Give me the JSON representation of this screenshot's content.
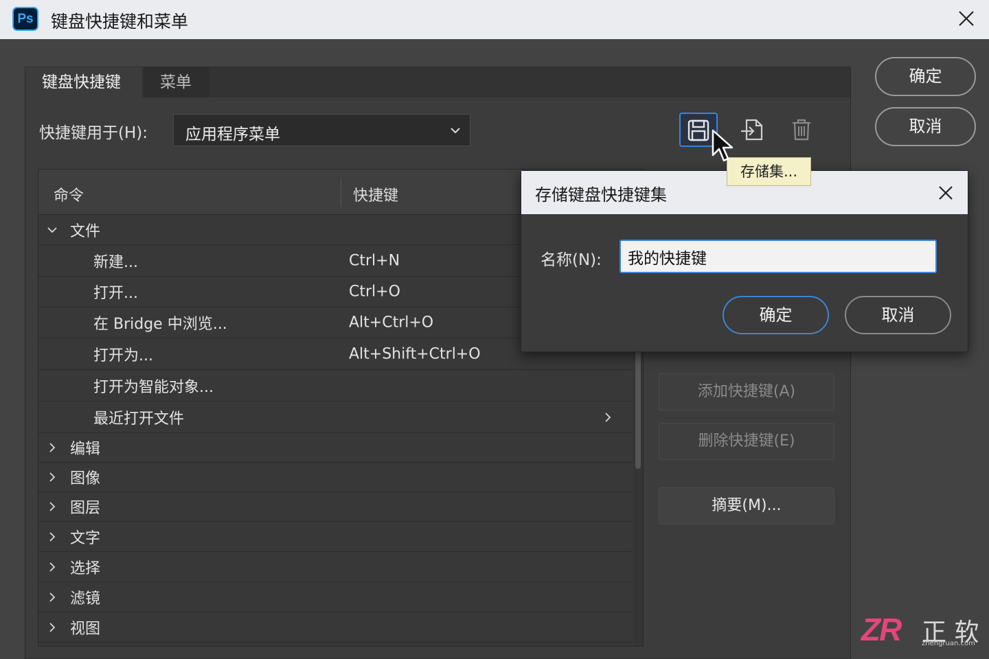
{
  "window": {
    "app_icon_text": "Ps",
    "title": "键盘快捷键和菜单"
  },
  "tabs": [
    {
      "label": "键盘快捷键",
      "active": true
    },
    {
      "label": "菜单",
      "active": false
    }
  ],
  "shortcut_for": {
    "label": "快捷键用于(H):",
    "value": "应用程序菜单"
  },
  "toolbar": {
    "icons": [
      "save-icon",
      "new-set-icon",
      "trash-icon"
    ],
    "tooltip": "存储集..."
  },
  "table": {
    "headers": {
      "command": "命令",
      "shortcut": "快捷键"
    },
    "rows": [
      {
        "command": "文件",
        "shortcut": "",
        "level": 0,
        "expanded": true
      },
      {
        "command": "新建...",
        "shortcut": "Ctrl+N",
        "level": 1
      },
      {
        "command": "打开...",
        "shortcut": "Ctrl+O",
        "level": 1
      },
      {
        "command": "在 Bridge 中浏览...",
        "shortcut": "Alt+Ctrl+O",
        "level": 1
      },
      {
        "command": "打开为...",
        "shortcut": "Alt+Shift+Ctrl+O",
        "level": 1
      },
      {
        "command": "打开为智能对象...",
        "shortcut": "",
        "level": 1
      },
      {
        "command": "最近打开文件",
        "shortcut": "",
        "level": 1,
        "submenu": true
      },
      {
        "command": "编辑",
        "shortcut": "",
        "level": 0
      },
      {
        "command": "图像",
        "shortcut": "",
        "level": 0
      },
      {
        "command": "图层",
        "shortcut": "",
        "level": 0
      },
      {
        "command": "文字",
        "shortcut": "",
        "level": 0
      },
      {
        "command": "选择",
        "shortcut": "",
        "level": 0
      },
      {
        "command": "滤镜",
        "shortcut": "",
        "level": 0
      },
      {
        "command": "视图",
        "shortcut": "",
        "level": 0
      }
    ]
  },
  "side_buttons": {
    "add_shortcut": "添加快捷键(A)",
    "delete_shortcut": "删除快捷键(E)",
    "summary": "摘要(M)..."
  },
  "main_buttons": {
    "ok": "确定",
    "cancel": "取消"
  },
  "modal": {
    "title": "存储键盘快捷键集",
    "name_label": "名称(N):",
    "name_value": "我的快捷键",
    "ok": "确定",
    "cancel": "取消"
  },
  "watermark": {
    "logo": "ZR",
    "brand": "正 软",
    "url": "zhengruan.com"
  },
  "colors": {
    "accent": "#3d84d6",
    "background": "#434343",
    "titlebar": "#ebecf0",
    "tooltip": "#f4f1c9"
  }
}
